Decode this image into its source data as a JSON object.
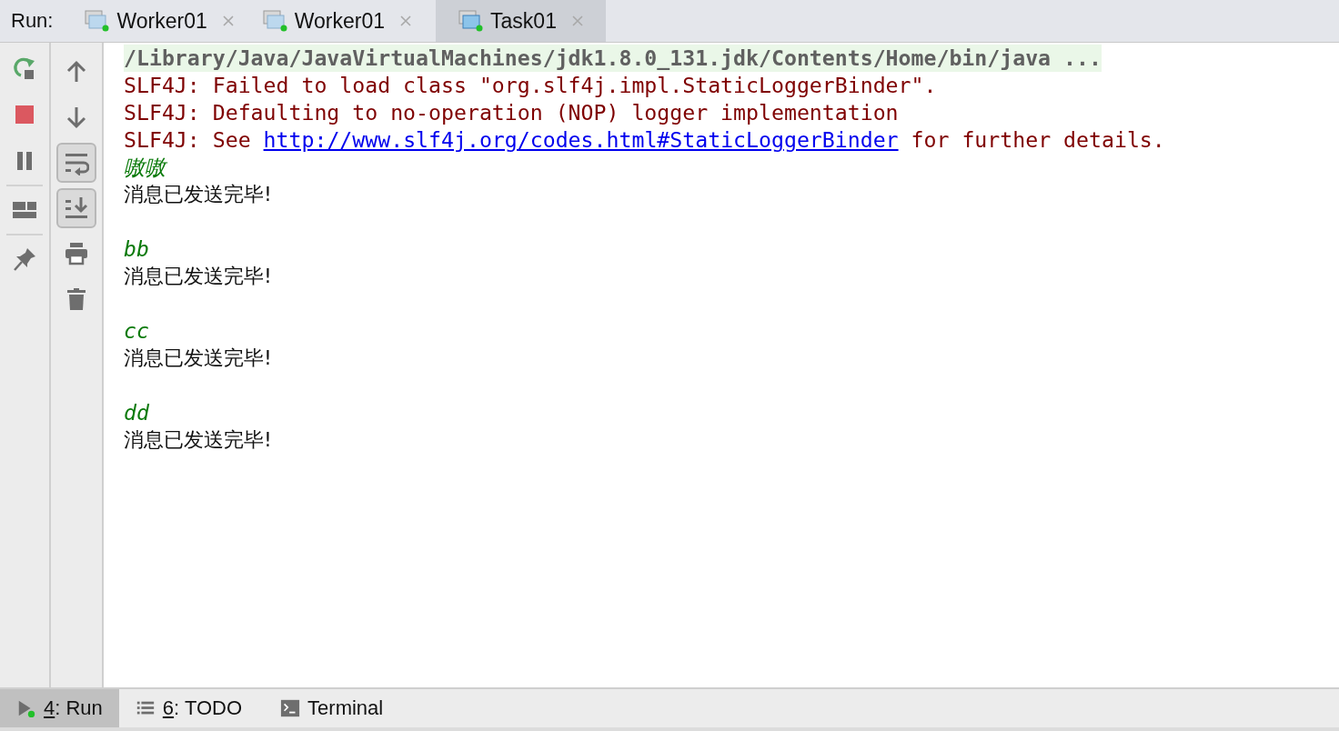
{
  "run_bar": {
    "label": "Run:",
    "tabs": [
      {
        "label": "Worker01",
        "selected": false
      },
      {
        "label": "Worker01",
        "selected": false
      },
      {
        "label": "Task01",
        "selected": true
      }
    ]
  },
  "left_toolbar": [
    {
      "kind": "rerun"
    },
    {
      "kind": "stop"
    },
    {
      "kind": "pause"
    },
    {
      "kind": "separator"
    },
    {
      "kind": "layout"
    },
    {
      "kind": "separator"
    },
    {
      "kind": "pin"
    }
  ],
  "console_toolbar": [
    {
      "kind": "up",
      "toggled": false
    },
    {
      "kind": "down",
      "toggled": false
    },
    {
      "kind": "wrap",
      "toggled": true
    },
    {
      "kind": "scroll-end",
      "toggled": true
    },
    {
      "kind": "print",
      "toggled": false
    },
    {
      "kind": "trash",
      "toggled": false
    }
  ],
  "console": [
    {
      "kind": "command",
      "text": "/Library/Java/JavaVirtualMachines/jdk1.8.0_131.jdk/Contents/Home/bin/java ..."
    },
    {
      "kind": "error",
      "text": "SLF4J: Failed to load class \"org.slf4j.impl.StaticLoggerBinder\"."
    },
    {
      "kind": "error",
      "text": "SLF4J: Defaulting to no-operation (NOP) logger implementation"
    },
    {
      "kind": "error_link",
      "before": "SLF4J: See",
      "link": "http://www.slf4j.org/codes.html#StaticLoggerBinder",
      "after": "for further details."
    },
    {
      "kind": "input",
      "text": "嗷嗷"
    },
    {
      "kind": "output",
      "text": "消息已发送完毕!"
    },
    {
      "kind": "blank"
    },
    {
      "kind": "input",
      "text": "bb"
    },
    {
      "kind": "output",
      "text": "消息已发送完毕!"
    },
    {
      "kind": "blank"
    },
    {
      "kind": "input",
      "text": "cc"
    },
    {
      "kind": "output",
      "text": "消息已发送完毕!"
    },
    {
      "kind": "blank"
    },
    {
      "kind": "input",
      "text": "dd"
    },
    {
      "kind": "output",
      "text": "消息已发送完毕!"
    }
  ],
  "tool_windows": [
    {
      "kind": "run",
      "mnemonic": "4",
      "label": ": Run",
      "selected": true
    },
    {
      "kind": "todo",
      "mnemonic": "6",
      "label": ": TODO",
      "selected": false
    },
    {
      "kind": "terminal",
      "label": "Terminal",
      "selected": false
    }
  ]
}
